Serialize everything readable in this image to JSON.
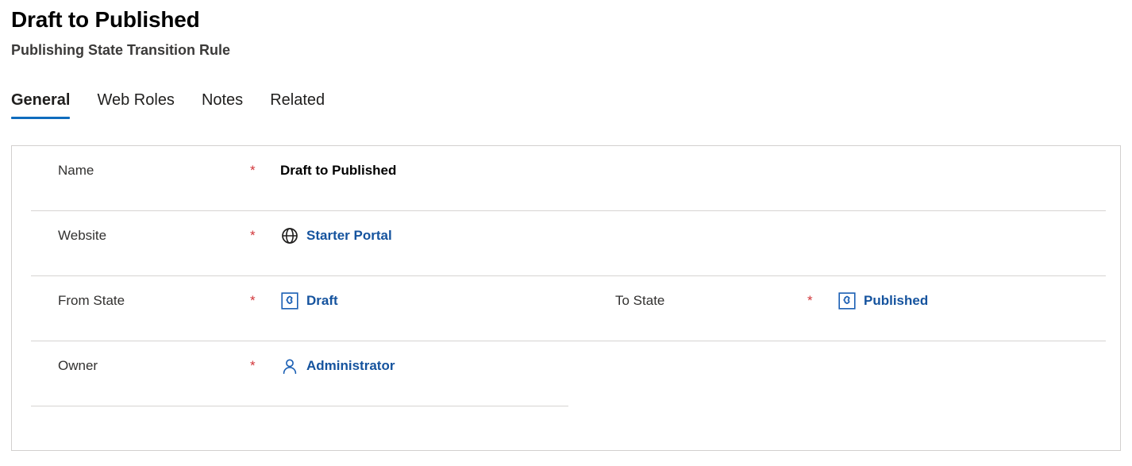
{
  "header": {
    "title": "Draft to Published",
    "subtitle": "Publishing State Transition Rule"
  },
  "tabs": [
    {
      "label": "General",
      "active": true
    },
    {
      "label": "Web Roles",
      "active": false
    },
    {
      "label": "Notes",
      "active": false
    },
    {
      "label": "Related",
      "active": false
    }
  ],
  "form": {
    "required_marker": "*",
    "rows": [
      {
        "left": {
          "label": "Name",
          "required": true,
          "value": "Draft to Published",
          "value_type": "text",
          "icon": null
        },
        "right": null,
        "separator": "full"
      },
      {
        "left": {
          "label": "Website",
          "required": true,
          "value": "Starter Portal",
          "value_type": "link",
          "icon": "globe-icon"
        },
        "right": null,
        "separator": "full"
      },
      {
        "left": {
          "label": "From State",
          "required": true,
          "value": "Draft",
          "value_type": "link",
          "icon": "puzzle-piece-icon"
        },
        "right": {
          "label": "To State",
          "required": true,
          "value": "Published",
          "value_type": "link",
          "icon": "puzzle-piece-icon"
        },
        "separator": "full"
      },
      {
        "left": {
          "label": "Owner",
          "required": true,
          "value": "Administrator",
          "value_type": "link",
          "icon": "person-icon"
        },
        "right": null,
        "separator": "half"
      }
    ]
  },
  "colors": {
    "accent": "#0f6cbd",
    "link": "#15539e",
    "required": "#d13438",
    "label": "#323130",
    "border": "#d2d0ce",
    "separator": "#d6d4d2"
  }
}
